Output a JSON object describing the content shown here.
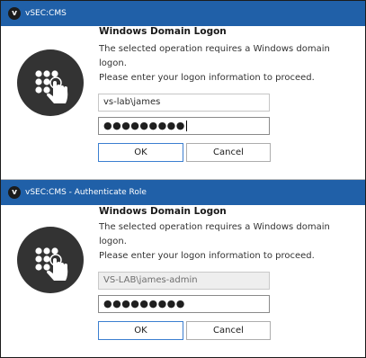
{
  "dialogs": [
    {
      "app_logo": "v",
      "title": "vSEC:CMS",
      "heading": "Windows Domain Logon",
      "message_line1": "The selected operation requires a Windows domain logon.",
      "message_line2": "Please enter your logon information to proceed.",
      "username": "vs-lab\\james",
      "username_disabled": false,
      "password_masked": "●●●●●●●●●",
      "ok_label": "OK",
      "cancel_label": "Cancel",
      "icon": "keypad-touch-icon"
    },
    {
      "app_logo": "v",
      "title": "vSEC:CMS - Authenticate Role",
      "heading": "Windows Domain Logon",
      "message_line1": "The selected operation requires a Windows domain logon.",
      "message_line2": "Please enter your logon information to proceed.",
      "username": "VS-LAB\\james-admin",
      "username_disabled": true,
      "password_masked": "●●●●●●●●●",
      "ok_label": "OK",
      "cancel_label": "Cancel",
      "icon": "keypad-touch-icon"
    }
  ],
  "colors": {
    "titlebar": "#2060a8",
    "icon_circle": "#333333",
    "default_button_border": "#3c7fd0"
  }
}
